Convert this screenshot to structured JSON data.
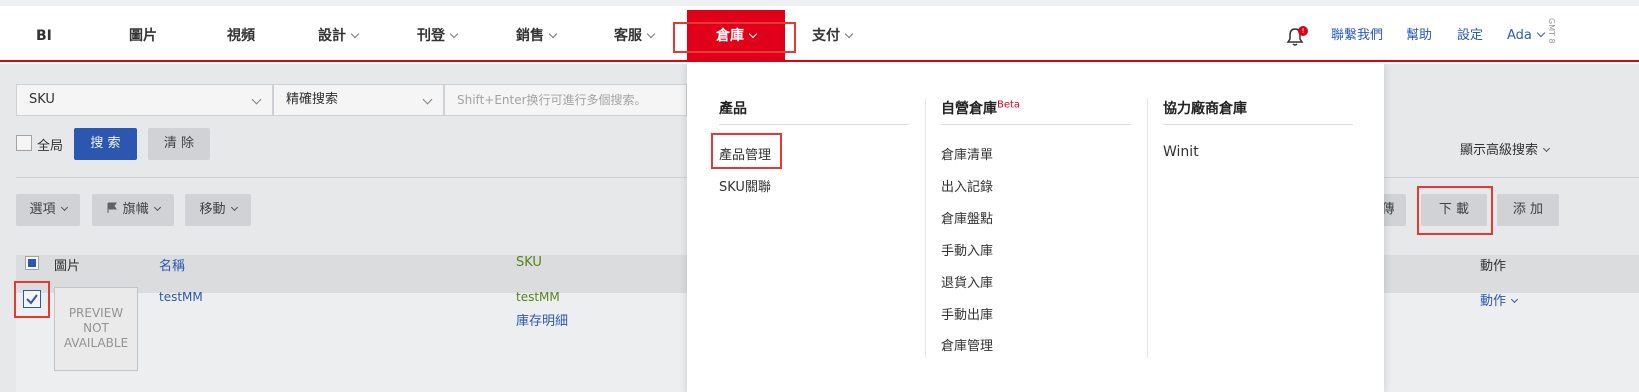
{
  "nav": {
    "items": [
      {
        "label": "BI",
        "has_chevron": false
      },
      {
        "label": "圖片",
        "has_chevron": false
      },
      {
        "label": "視頻",
        "has_chevron": false
      },
      {
        "label": "設計",
        "has_chevron": true
      },
      {
        "label": "刊登",
        "has_chevron": true
      },
      {
        "label": "銷售",
        "has_chevron": true
      },
      {
        "label": "客服",
        "has_chevron": true
      },
      {
        "label": "倉庫",
        "has_chevron": true,
        "active": true
      },
      {
        "label": "支付",
        "has_chevron": true
      }
    ],
    "notification_count": "!",
    "contact": "聯繫我們",
    "help": "幫助",
    "settings": "設定",
    "user": "Ada",
    "timezone": "GMT 8"
  },
  "search": {
    "field_select": "SKU",
    "mode_select": "精確搜索",
    "placeholder": "Shift+Enter换行可進行多個搜索。",
    "global_label": "全局",
    "search_button": "搜 索",
    "clear_button": "清 除",
    "advanced_link": "顯示高級搜索"
  },
  "toolbar": {
    "options": "選項",
    "flag": "旗幟",
    "move": "移動",
    "upload_partial": "傳",
    "download": "下 載",
    "add": "添 加"
  },
  "table": {
    "headers": {
      "image": "圖片",
      "name": "名稱",
      "sku": "SKU",
      "action": "動作"
    },
    "rows": [
      {
        "name": "testMM",
        "sku": "testMM",
        "sku_link": "庫存明細",
        "action": "動作",
        "image_placeholder": "PREVIEW NOT AVAILABLE",
        "checked": true
      }
    ]
  },
  "dropdown": {
    "columns": [
      {
        "title": "產品",
        "beta": "",
        "items": [
          "產品管理",
          "SKU關聯"
        ]
      },
      {
        "title": "自營倉庫",
        "beta": "Beta",
        "items": [
          "倉庫清單",
          "出入記錄",
          "倉庫盤點",
          "手動入庫",
          "退貨入庫",
          "手動出庫",
          "倉庫管理"
        ]
      },
      {
        "title": "協力廠商倉庫",
        "beta": "",
        "items": [
          "Winit"
        ]
      }
    ]
  },
  "colors": {
    "brand_red": "#e0001a",
    "primary_blue": "#2d5bb9",
    "highlight_box": "#e53935"
  }
}
